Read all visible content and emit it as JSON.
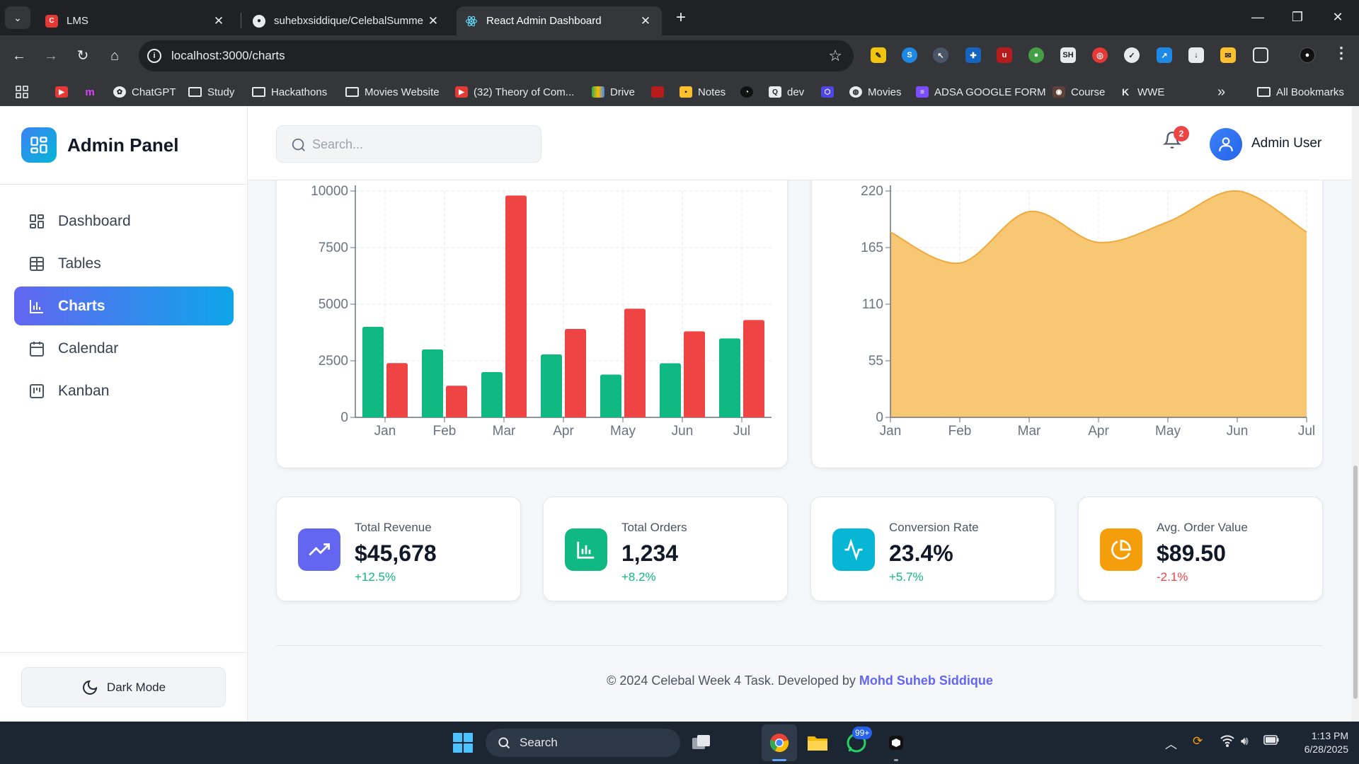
{
  "browser": {
    "tabs": [
      {
        "title": "LMS",
        "favicon": "lms-icon",
        "active": false
      },
      {
        "title": "suhebxsiddique/CelebalSumme",
        "favicon": "github-icon",
        "active": false
      },
      {
        "title": "React Admin Dashboard",
        "favicon": "react-icon",
        "active": true
      }
    ],
    "url": "localhost:3000/charts",
    "bookmarks": [
      {
        "label": "",
        "icon": "youtube-icon"
      },
      {
        "label": "",
        "icon": "m-icon"
      },
      {
        "label": "ChatGPT",
        "icon": "chatgpt-icon"
      },
      {
        "label": "Study",
        "icon": "folder-icon"
      },
      {
        "label": "Hackathons",
        "icon": "folder-icon"
      },
      {
        "label": "Movies Website",
        "icon": "folder-icon"
      },
      {
        "label": "(32) Theory of Com...",
        "icon": "youtube-icon"
      },
      {
        "label": "Drive",
        "icon": "drive-icon"
      },
      {
        "label": "",
        "icon": "red-square-icon"
      },
      {
        "label": "Notes",
        "icon": "notes-icon"
      },
      {
        "label": "",
        "icon": "speed-icon"
      },
      {
        "label": "dev",
        "icon": "dev-icon"
      },
      {
        "label": "",
        "icon": "hex-icon"
      },
      {
        "label": "Movies",
        "icon": "globe-icon"
      },
      {
        "label": "ADSA GOOGLE FORM",
        "icon": "form-icon"
      },
      {
        "label": "Course",
        "icon": "course-icon"
      },
      {
        "label": "WWE",
        "icon": "k-icon"
      }
    ],
    "all_bookmarks": "All Bookmarks",
    "overflow": "»"
  },
  "app": {
    "brand": "Admin Panel",
    "nav": [
      {
        "label": "Dashboard",
        "icon": "dashboard-icon",
        "active": false
      },
      {
        "label": "Tables",
        "icon": "table-icon",
        "active": false
      },
      {
        "label": "Charts",
        "icon": "bar-chart-icon",
        "active": true
      },
      {
        "label": "Calendar",
        "icon": "calendar-icon",
        "active": false
      },
      {
        "label": "Kanban",
        "icon": "kanban-icon",
        "active": false
      }
    ],
    "dark_mode_label": "Dark Mode",
    "search_placeholder": "Search...",
    "notification_count": "2",
    "user_name": "Admin User",
    "colors": {
      "green": "#10b981",
      "red": "#ef4444",
      "orange_fill": "#f8c46d",
      "orange_line": "#f0a93c",
      "accent": "#6366f1"
    }
  },
  "chart_data": [
    {
      "type": "bar",
      "categories": [
        "Jan",
        "Feb",
        "Mar",
        "Apr",
        "May",
        "Jun",
        "Jul"
      ],
      "ylim": [
        0,
        10000
      ],
      "yticks": [
        "0",
        "2500",
        "5000",
        "7500",
        "10000"
      ],
      "grid": true,
      "series": [
        {
          "color": "#10b981",
          "values": [
            4000,
            3000,
            2000,
            2780,
            1890,
            2390,
            3490
          ]
        },
        {
          "color": "#ef4444",
          "values": [
            2400,
            1398,
            9800,
            3908,
            4800,
            3800,
            4300
          ]
        }
      ]
    },
    {
      "type": "area",
      "categories": [
        "Jan",
        "Feb",
        "Mar",
        "Apr",
        "May",
        "Jun",
        "Jul"
      ],
      "ylim": [
        0,
        220
      ],
      "yticks": [
        "0",
        "55",
        "110",
        "165",
        "220"
      ],
      "grid": true,
      "series": [
        {
          "color": "#f8c46d",
          "values": [
            180,
            150,
            200,
            170,
            190,
            220,
            180
          ]
        }
      ]
    }
  ],
  "stats": [
    {
      "label": "Total Revenue",
      "value": "$45,678",
      "change": "+12.5%",
      "trend": "up",
      "icon": "trending-up-icon",
      "color": "#6366f1"
    },
    {
      "label": "Total Orders",
      "value": "1,234",
      "change": "+8.2%",
      "trend": "up",
      "icon": "bar-chart-icon",
      "color": "#10b981"
    },
    {
      "label": "Conversion Rate",
      "value": "23.4%",
      "change": "+5.7%",
      "trend": "up",
      "icon": "activity-icon",
      "color": "#06b6d4"
    },
    {
      "label": "Avg. Order Value",
      "value": "$89.50",
      "change": "-2.1%",
      "trend": "down",
      "icon": "pie-chart-icon",
      "color": "#f59e0b"
    }
  ],
  "footer": {
    "text": "© 2024 Celebal Week 4 Task. Developed by ",
    "author": "Mohd Suheb Siddique"
  },
  "taskbar": {
    "search_label": "Search",
    "whatsapp_badge": "99+",
    "time": "1:13 PM",
    "date": "6/28/2025"
  }
}
